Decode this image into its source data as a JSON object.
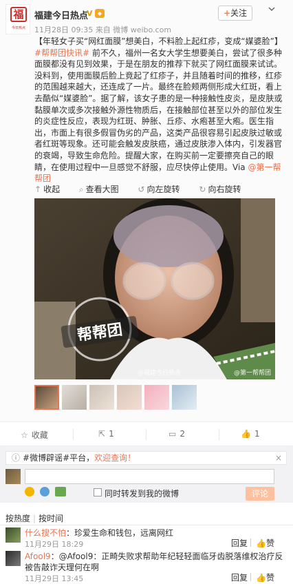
{
  "post": {
    "author": "福建今日热点",
    "verified_badge": "V",
    "time": "11月28日 09:35",
    "source_prefix": "来自",
    "source": "微博 weibo.com",
    "follow_label": "关注",
    "avatar_text": "福",
    "avatar_subtext": "今日热点",
    "content": {
      "part1": "【年轻女子买“网红面膜”想美白，不料脸上起红疹，变成“媒婆脸”】",
      "hashtag": "#帮帮团快讯#",
      "part2": " 前不久，福州一名女大学生想要美白，尝试了很多种面膜都没有见到效果，于是在朋友的推荐下就买了网红面膜来试试。没料到，使用面膜后脸上竟起了红疹子，并且随着时间的推移，红疹的范围越来越大，还连成了一片。最终在脸颊两侧形成大红斑，看上去酷似“媒婆脸”。据了解，该女子患的是一种接触性皮炎，是皮肤或黏膜单次或多次接触外源性物质后，在接触部位甚至以外的部位发生的炎症性反应，表现为红斑、肿胀、丘疹、水疱甚至大疱。医生指出，市面上有很多假冒伪劣的产品，这类产品很容易引起皮肤过敏或者红斑等现象。还可能会触发皮肤癌，通过皮肤渗入体内，引发器官的衰竭，导致生命危险。提醒大家，在购买前一定要擦亮自己的眼睛，在使用过程中一旦感觉不舒服，应尽快停止使用。Via ",
      "mention": "@第一帮帮团"
    },
    "image_toolbar": {
      "collapse": "收起",
      "view_large": "查看大图",
      "rotate_left": "向左旋转",
      "rotate_right": "向右旋转"
    },
    "watermark": "帮帮团",
    "image_credit_left": "@福建今日热点",
    "image_credit_right": "@第一帮帮团",
    "actions": {
      "favorite": "收藏",
      "repost_count": "1",
      "comment_count": "2",
      "like_count": "1"
    }
  },
  "comment_box": {
    "notice_prefix": "#微博辟谣#平台，",
    "notice_highlight": "欢迎查询！",
    "also_repost": "同时转发到我的微博",
    "submit": "评论"
  },
  "sort": {
    "by_heat": "按热度",
    "by_time": "按时间"
  },
  "comments": [
    {
      "user": "什么搜不怕",
      "text": "：珍爱生命和钱包，远离网红",
      "time": "11月29日 18:29",
      "reply": "回复",
      "like": "赞"
    },
    {
      "user": "Afool9",
      "text": "：@Afool9：正畸失败求帮助年纪轻轻面临牙齿脱落维权治疗反被告敲诈天理何在啊",
      "time": "11月29日 13:45",
      "reply": "回复",
      "like": "赞"
    }
  ],
  "colors": {
    "accent": "#eb7350",
    "submit_bg": "#ffc09f",
    "seal_red": "#c9302c"
  }
}
